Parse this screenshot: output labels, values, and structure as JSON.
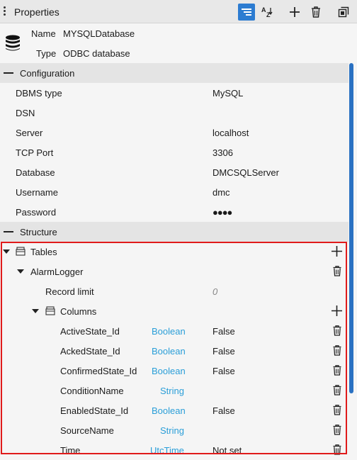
{
  "panel": {
    "title": "Properties",
    "toolbar": {
      "categorized_icon": "categorized-icon",
      "sort_icon": "sort-az-icon",
      "add_icon": "plus-icon",
      "delete_icon": "trash-icon",
      "popout_icon": "popout-icon"
    }
  },
  "header": {
    "name_label": "Name",
    "name_value": "MYSQLDatabase",
    "type_label": "Type",
    "type_value": "ODBC database"
  },
  "configuration": {
    "title": "Configuration",
    "rows": [
      {
        "key": "DBMS type",
        "value": "MySQL"
      },
      {
        "key": "DSN",
        "value": ""
      },
      {
        "key": "Server",
        "value": "localhost"
      },
      {
        "key": "TCP Port",
        "value": "3306"
      },
      {
        "key": "Database",
        "value": "DMCSQLServer"
      },
      {
        "key": "Username",
        "value": "dmc"
      },
      {
        "key": "Password",
        "value": "●●●●"
      }
    ]
  },
  "structure": {
    "title": "Structure",
    "tables_label": "Tables",
    "table_name": "AlarmLogger",
    "record_limit_label": "Record limit",
    "record_limit_value": "0",
    "columns_label": "Columns",
    "columns": [
      {
        "name": "ActiveState_Id",
        "type": "Boolean",
        "default": "False"
      },
      {
        "name": "AckedState_Id",
        "type": "Boolean",
        "default": "False"
      },
      {
        "name": "ConfirmedState_Id",
        "type": "Boolean",
        "default": "False"
      },
      {
        "name": "ConditionName",
        "type": "String",
        "default": ""
      },
      {
        "name": "EnabledState_Id",
        "type": "Boolean",
        "default": "False"
      },
      {
        "name": "SourceName",
        "type": "String",
        "default": ""
      },
      {
        "name": "Time",
        "type": "UtcTime",
        "default": "Not set"
      }
    ]
  },
  "colors": {
    "accent": "#2c7cd1",
    "type_text": "#2a9ed8",
    "highlight": "#e01b1b"
  }
}
